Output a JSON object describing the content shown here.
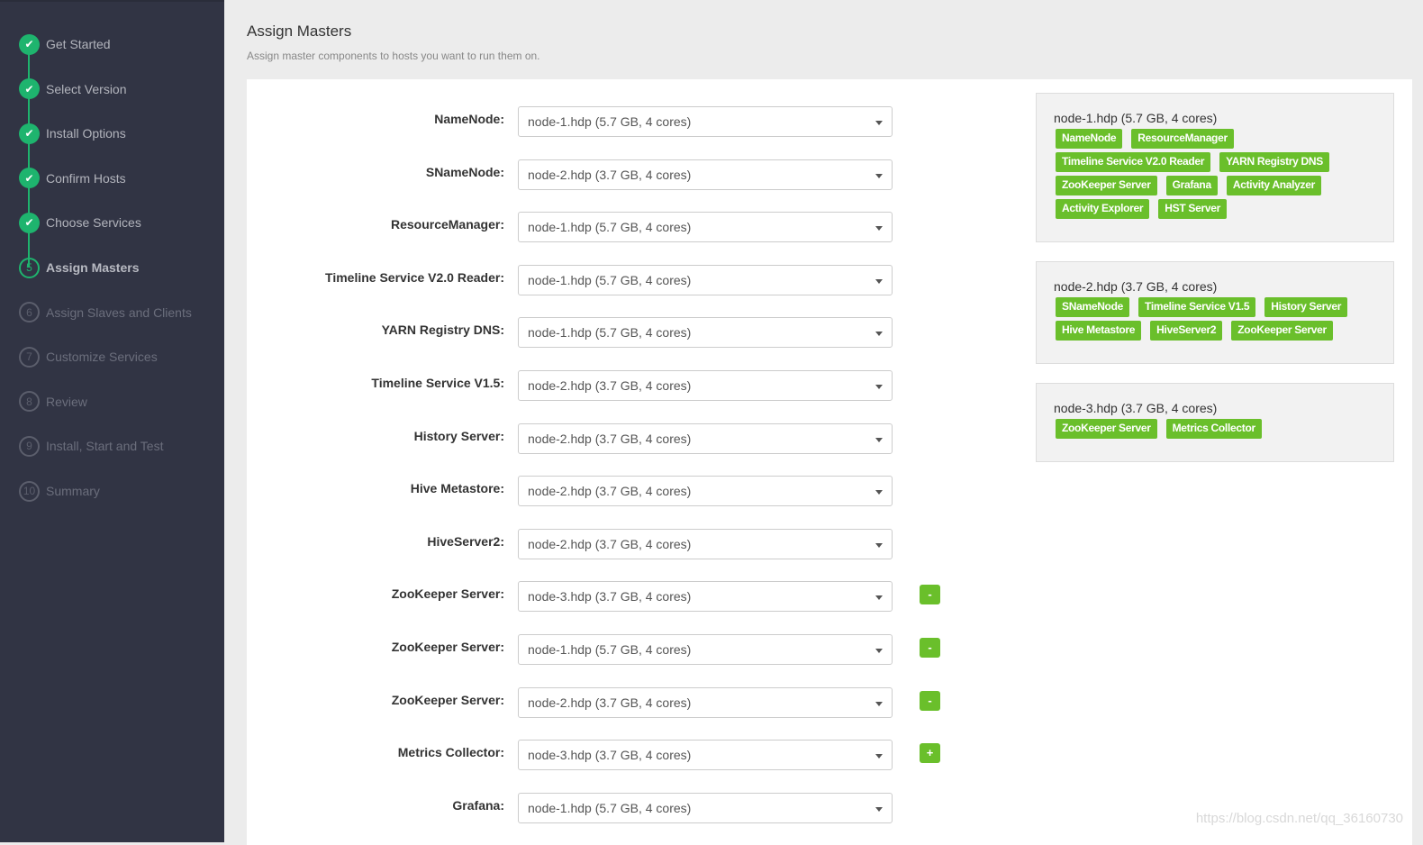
{
  "sidebar": {
    "steps": [
      {
        "num": "1",
        "label": "Get Started",
        "state": "done"
      },
      {
        "num": "2",
        "label": "Select Version",
        "state": "done"
      },
      {
        "num": "3",
        "label": "Install Options",
        "state": "done"
      },
      {
        "num": "4",
        "label": "Confirm Hosts",
        "state": "done"
      },
      {
        "num": "5",
        "label": "Choose Services",
        "state": "done"
      },
      {
        "num": "5",
        "label": "Assign Masters",
        "state": "current"
      },
      {
        "num": "6",
        "label": "Assign Slaves and Clients",
        "state": "todo"
      },
      {
        "num": "7",
        "label": "Customize Services",
        "state": "todo"
      },
      {
        "num": "8",
        "label": "Review",
        "state": "todo"
      },
      {
        "num": "9",
        "label": "Install, Start and Test",
        "state": "todo"
      },
      {
        "num": "10",
        "label": "Summary",
        "state": "todo"
      }
    ]
  },
  "header": {
    "title": "Assign Masters",
    "subtitle": "Assign master components to hosts you want to run them on."
  },
  "assignments": [
    {
      "label": "NameNode:",
      "value": "node-1.hdp (5.7 GB, 4 cores)",
      "action": ""
    },
    {
      "label": "SNameNode:",
      "value": "node-2.hdp (3.7 GB, 4 cores)",
      "action": ""
    },
    {
      "label": "ResourceManager:",
      "value": "node-1.hdp (5.7 GB, 4 cores)",
      "action": ""
    },
    {
      "label": "Timeline Service V2.0 Reader:",
      "value": "node-1.hdp (5.7 GB, 4 cores)",
      "action": ""
    },
    {
      "label": "YARN Registry DNS:",
      "value": "node-1.hdp (5.7 GB, 4 cores)",
      "action": ""
    },
    {
      "label": "Timeline Service V1.5:",
      "value": "node-2.hdp (3.7 GB, 4 cores)",
      "action": ""
    },
    {
      "label": "History Server:",
      "value": "node-2.hdp (3.7 GB, 4 cores)",
      "action": ""
    },
    {
      "label": "Hive Metastore:",
      "value": "node-2.hdp (3.7 GB, 4 cores)",
      "action": ""
    },
    {
      "label": "HiveServer2:",
      "value": "node-2.hdp (3.7 GB, 4 cores)",
      "action": ""
    },
    {
      "label": "ZooKeeper Server:",
      "value": "node-3.hdp (3.7 GB, 4 cores)",
      "action": "-"
    },
    {
      "label": "ZooKeeper Server:",
      "value": "node-1.hdp (5.7 GB, 4 cores)",
      "action": "-"
    },
    {
      "label": "ZooKeeper Server:",
      "value": "node-2.hdp (3.7 GB, 4 cores)",
      "action": "-"
    },
    {
      "label": "Metrics Collector:",
      "value": "node-3.hdp (3.7 GB, 4 cores)",
      "action": "+"
    },
    {
      "label": "Grafana:",
      "value": "node-1.hdp (5.7 GB, 4 cores)",
      "action": ""
    }
  ],
  "hosts": [
    {
      "name": "node-1.hdp (5.7 GB, 4 cores)",
      "components": [
        "NameNode",
        "ResourceManager",
        "Timeline Service V2.0 Reader",
        "YARN Registry DNS",
        "ZooKeeper Server",
        "Grafana",
        "Activity Analyzer",
        "Activity Explorer",
        "HST Server"
      ]
    },
    {
      "name": "node-2.hdp (3.7 GB, 4 cores)",
      "components": [
        "SNameNode",
        "Timeline Service V1.5",
        "History Server",
        "Hive Metastore",
        "HiveServer2",
        "ZooKeeper Server"
      ]
    },
    {
      "name": "node-3.hdp (3.7 GB, 4 cores)",
      "components": [
        "ZooKeeper Server",
        "Metrics Collector"
      ]
    }
  ],
  "colors": {
    "sidebar": "#313444",
    "accent": "#1eb46e",
    "tag": "#6abf2b"
  },
  "watermark": "https://blog.csdn.net/qq_36160730"
}
